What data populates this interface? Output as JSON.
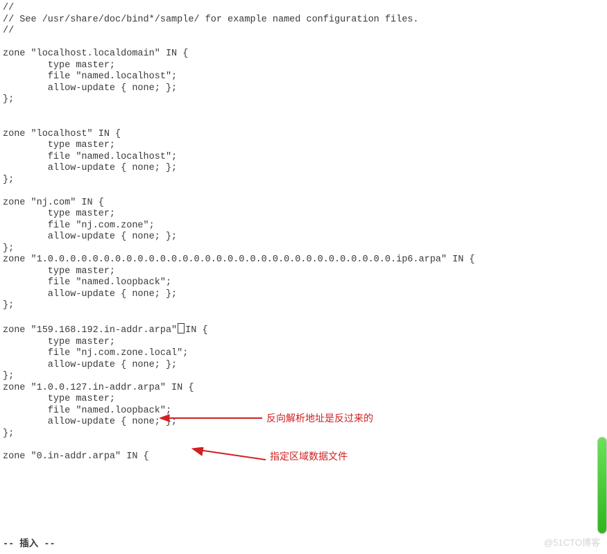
{
  "code": {
    "l01": "//",
    "l02": "// See /usr/share/doc/bind*/sample/ for example named configuration files.",
    "l03": "//",
    "l04": "",
    "l05": "zone \"localhost.localdomain\" IN {",
    "l06": "        type master;",
    "l07": "        file \"named.localhost\";",
    "l08": "        allow-update { none; };",
    "l09": "};",
    "l10": "",
    "l11": "",
    "l12": "zone \"localhost\" IN {",
    "l13": "        type master;",
    "l14": "        file \"named.localhost\";",
    "l15": "        allow-update { none; };",
    "l16": "};",
    "l17": "",
    "l18": "zone \"nj.com\" IN {",
    "l19": "        type master;",
    "l20": "        file \"nj.com.zone\";",
    "l21": "        allow-update { none; };",
    "l22": "};",
    "l23": "zone \"1.0.0.0.0.0.0.0.0.0.0.0.0.0.0.0.0.0.0.0.0.0.0.0.0.0.0.0.0.0.0.0.ip6.arpa\" IN {",
    "l24": "        type master;",
    "l25": "        file \"named.loopback\";",
    "l26": "        allow-update { none; };",
    "l27": "};",
    "l28": "",
    "l29a": "zone \"159.168.192.in-addr.arpa\"",
    "l29b": "IN {",
    "l30": "        type master;",
    "l31": "        file \"nj.com.zone.local\";",
    "l32": "        allow-update { none; };",
    "l33": "};",
    "l34": "zone \"1.0.0.127.in-addr.arpa\" IN {",
    "l35": "        type master;",
    "l36": "        file \"named.loopback\";",
    "l37": "        allow-update { none; };",
    "l38": "};",
    "l39": "",
    "l40": "zone \"0.in-addr.arpa\" IN {"
  },
  "annotations": {
    "a1": "反向解析地址是反过来的",
    "a2": "指定区域数据文件"
  },
  "status": "-- 插入 --",
  "watermark": "@51CTO博客"
}
